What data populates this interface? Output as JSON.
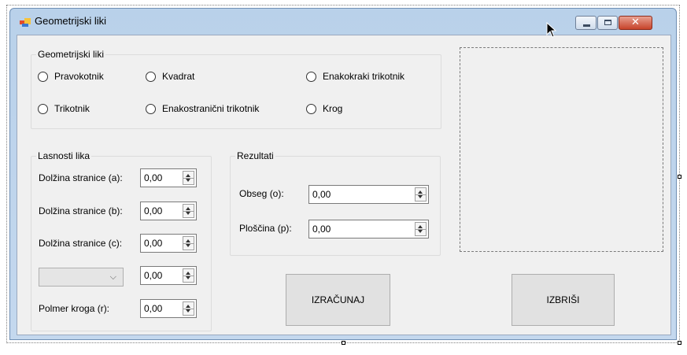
{
  "window": {
    "title": "Geometrijski liki"
  },
  "shapes_group": {
    "title": "Geometrijski liki",
    "options": [
      {
        "label": "Pravokotnik"
      },
      {
        "label": "Kvadrat"
      },
      {
        "label": "Enakokraki trikotnik"
      },
      {
        "label": "Trikotnik"
      },
      {
        "label": "Enakostranični trikotnik"
      },
      {
        "label": "Krog"
      }
    ]
  },
  "properties_group": {
    "title": "Lasnosti lika",
    "side_a": {
      "label": "Dolžina stranice (a):",
      "value": "0,00"
    },
    "side_b": {
      "label": "Dolžina stranice (b):",
      "value": "0,00"
    },
    "side_c": {
      "label": "Dolžina stranice (c):",
      "value": "0,00"
    },
    "extra": {
      "combo_value": "",
      "value": "0,00"
    },
    "radius": {
      "label": "Polmer kroga (r):",
      "value": "0,00"
    }
  },
  "results_group": {
    "title": "Rezultati",
    "perimeter": {
      "label": "Obseg (o):",
      "value": "0,00"
    },
    "area": {
      "label": "Ploščina (p):",
      "value": "0,00"
    }
  },
  "buttons": {
    "calculate": "IZRAČUNAJ",
    "clear": "IZBRIŠI"
  },
  "colors": {
    "client_bg": "#f0f0f0",
    "titlebar": "#b9d1ea",
    "close_btn": "#c7432a"
  },
  "icons": [
    "app-icon",
    "minimize-icon",
    "maximize-icon",
    "close-icon",
    "mouse-cursor-icon"
  ]
}
